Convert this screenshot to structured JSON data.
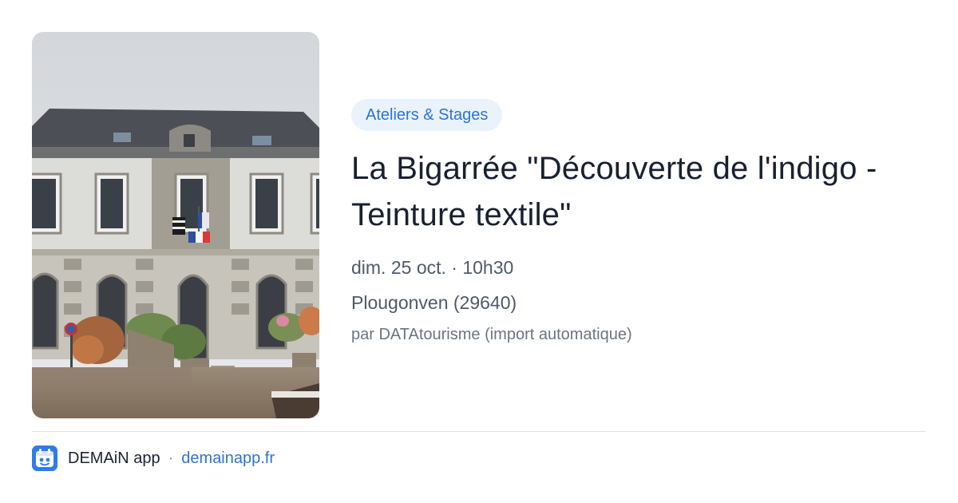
{
  "event": {
    "category": "Ateliers & Stages",
    "title": "La Bigarrée \"Découverte de l'indigo - Teinture textile\"",
    "date": "dim. 25 oct. · 10h30",
    "location": "Plougonven (29640)",
    "source": "par DATAtourisme (import automatique)"
  },
  "footer": {
    "app_name": "DEMAiN app",
    "separator": "·",
    "link": "demainapp.fr"
  },
  "colors": {
    "accent": "#2c74d3",
    "pill_bg": "#eaf2fc",
    "title": "#19202f",
    "meta": "#505968"
  },
  "icons": {
    "app_logo": "demain-app-logo-icon"
  }
}
